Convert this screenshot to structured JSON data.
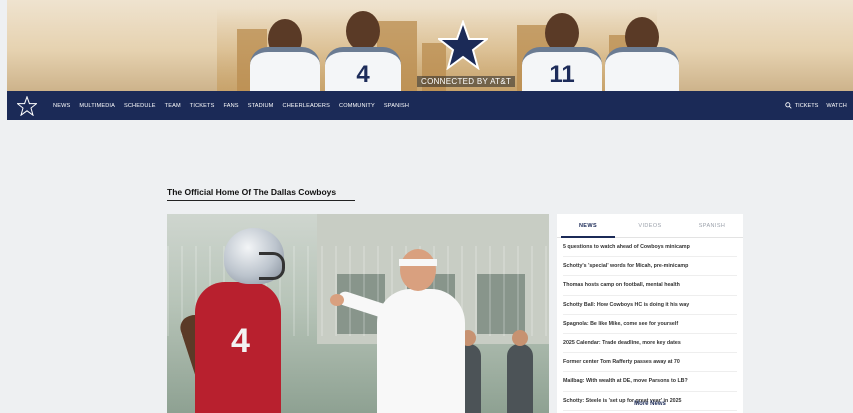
{
  "banner": {
    "connected_text": "CONNECTED BY AT&T",
    "players": [
      {
        "number": ""
      },
      {
        "number": "4"
      },
      {
        "number": "11"
      },
      {
        "number": ""
      }
    ]
  },
  "nav": {
    "items": [
      "NEWS",
      "MULTIMEDIA",
      "SCHEDULE",
      "TEAM",
      "TICKETS",
      "FANS",
      "STADIUM",
      "CHEERLEADERS",
      "COMMUNITY",
      "SPANISH"
    ],
    "right": {
      "tickets": "TICKETS",
      "watch": "WATCH"
    }
  },
  "main": {
    "title": "The Official Home Of The Dallas Cowboys",
    "hero": {
      "qb_number": "4"
    }
  },
  "news_panel": {
    "tabs": [
      "NEWS",
      "VIDEOS",
      "SPANISH"
    ],
    "active_tab": "NEWS",
    "headlines": [
      "5 questions to watch ahead of Cowboys minicamp",
      "Schotty's 'special' words for Micah, pre-minicamp",
      "Thomas hosts camp on football, mental health",
      "Schotty Ball: How Cowboys HC is doing it his way",
      "Spagnola: Be like Mike, come see for yourself",
      "2025 Calendar: Trade deadline, more key dates",
      "Former center Tom Rafferty passes away at 70",
      "Mailbag: With wealth at DE, move Parsons to LB?",
      "Schotty: Steele is 'set up for great year' in 2025"
    ],
    "more_label": "More News"
  },
  "colors": {
    "navy": "#1b2a57",
    "cowboys_red": "#b8202e",
    "silver": "#bcc4cd"
  }
}
